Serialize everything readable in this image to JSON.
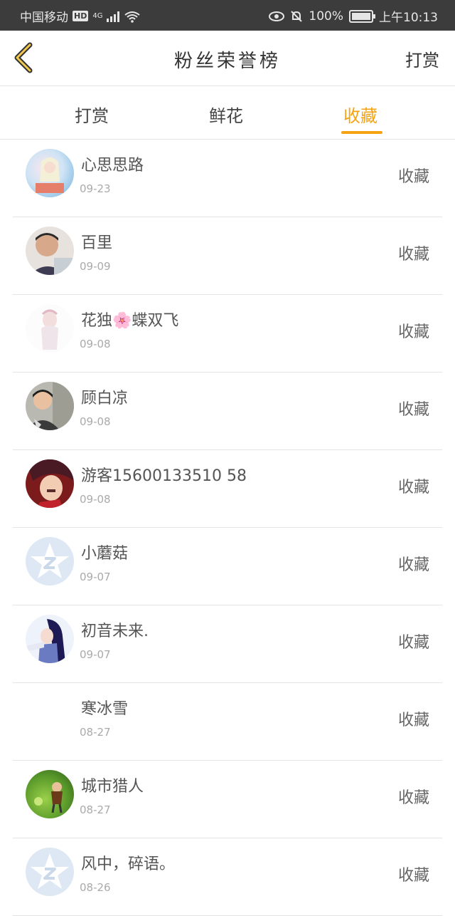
{
  "status_bar": {
    "carrier": "中国移动",
    "hd_badge": "HD",
    "network": "4G",
    "battery_text": "100%",
    "time": "上午10:13"
  },
  "header": {
    "title": "粉丝荣誉榜",
    "right_label": "打赏",
    "back_icon": "chevron-left-icon"
  },
  "tabs": [
    {
      "label": "打赏",
      "active": false
    },
    {
      "label": "鲜花",
      "active": false
    },
    {
      "label": "收藏",
      "active": true
    }
  ],
  "colors": {
    "accent": "#f5a312",
    "status_bar_bg": "#3c3c3c",
    "divider": "#e4e4e4"
  },
  "fans": [
    {
      "name": "心思思路",
      "date": "09-23",
      "action": "收藏",
      "avatar": "anime-girl-avatar"
    },
    {
      "name": "百里",
      "date": "09-09",
      "action": "收藏",
      "avatar": "photo-avatar"
    },
    {
      "name": "花独🌸蝶双飞",
      "date": "09-08",
      "action": "收藏",
      "avatar": "faded-figure-avatar"
    },
    {
      "name": "顾白凉",
      "date": "09-08",
      "action": "收藏",
      "avatar": "photo-avatar"
    },
    {
      "name": "游客15600133510 58",
      "date": "09-08",
      "action": "收藏",
      "avatar": "anime-avatar"
    },
    {
      "name": "小蘑菇",
      "date": "09-07",
      "action": "收藏",
      "avatar": "default-star-avatar"
    },
    {
      "name": "初音未来.",
      "date": "09-07",
      "action": "收藏",
      "avatar": "anime-avatar"
    },
    {
      "name": "寒冰雪",
      "date": "08-27",
      "action": "收藏",
      "avatar": "blank-avatar"
    },
    {
      "name": "城市猎人",
      "date": "08-27",
      "action": "收藏",
      "avatar": "game-avatar"
    },
    {
      "name": "风中，碎语。",
      "date": "08-26",
      "action": "收藏",
      "avatar": "default-star-avatar"
    }
  ]
}
